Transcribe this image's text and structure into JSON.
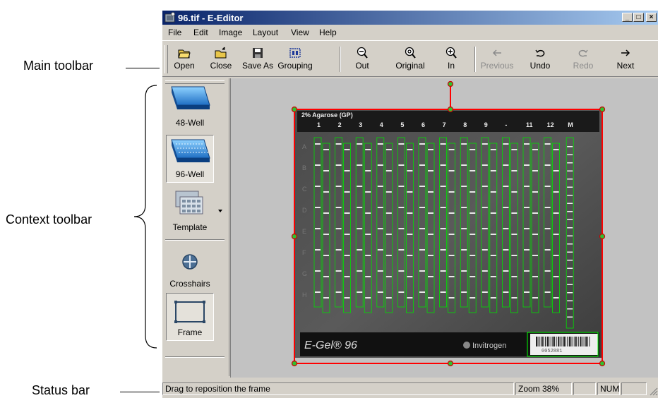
{
  "callouts": {
    "main_toolbar": "Main toolbar",
    "context_toolbar": "Context toolbar",
    "status_bar": "Status bar"
  },
  "window": {
    "title": "96.tif - E-Editor",
    "controls": {
      "minimize": "_",
      "maximize": "□",
      "close": "×"
    }
  },
  "menu": [
    "File",
    "Edit",
    "Image",
    "Layout",
    "View",
    "Help"
  ],
  "toolbar": {
    "open": "Open",
    "close": "Close",
    "save_as": "Save As",
    "grouping": "Grouping",
    "zoom_out": "Out",
    "original": "Original",
    "zoom_in": "In",
    "previous": "Previous",
    "undo": "Undo",
    "redo": "Redo",
    "next": "Next"
  },
  "context": {
    "well48": "48-Well",
    "well96": "96-Well",
    "template": "Template",
    "crosshairs": "Crosshairs",
    "frame": "Frame"
  },
  "gel": {
    "header": "2% Agarose (GP)",
    "lanes": [
      "1",
      "2",
      "3",
      "4",
      "5",
      "6",
      "7",
      "8",
      "9",
      "-",
      "11",
      "12",
      "M"
    ],
    "rows": [
      "A",
      "B",
      "C",
      "D",
      "E",
      "F",
      "G",
      "H"
    ],
    "brand": "E-Gel® 96",
    "maker": "Invitrogen",
    "barcode": "0052881"
  },
  "status": {
    "message": "Drag to reposition the frame",
    "zoom": "Zoom 38%",
    "num": "NUM"
  },
  "colors": {
    "titlebar_start": "#0a246a",
    "titlebar_end": "#a6caf0",
    "frame": "#ff0000",
    "handle": "#30c030",
    "lane_box": "#00ff00"
  }
}
